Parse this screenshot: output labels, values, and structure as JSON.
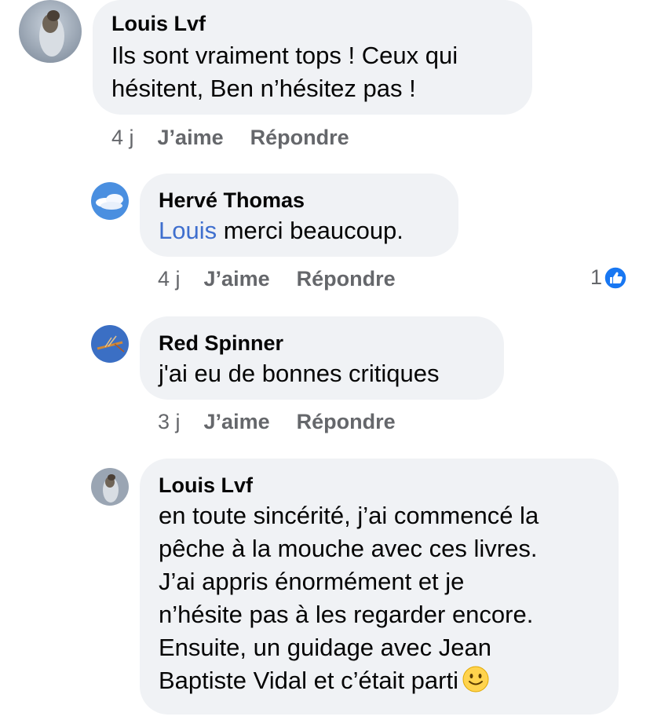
{
  "comments": [
    {
      "author": "Louis Lvf",
      "text": "Ils sont vraiment tops ! Ceux qui\nhésitent, Ben n’hésitez pas !",
      "time": "4 j",
      "like_label": "J’aime",
      "reply_label": "Répondre"
    },
    {
      "author": "Hervé Thomas",
      "mention": "Louis",
      "text": " merci beaucoup.",
      "time": "4 j",
      "like_label": "J’aime",
      "reply_label": "Répondre",
      "reaction_count": "1",
      "reaction_icon": "thumbs-up-icon"
    },
    {
      "author": "Red Spinner",
      "text": "j'ai eu de bonnes critiques",
      "time": "3 j",
      "like_label": "J’aime",
      "reply_label": "Répondre"
    },
    {
      "author": "Louis Lvf",
      "text": "en toute sincérité, j’ai commencé la\npêche à la mouche avec ces livres.\nJ’ai appris énormément et je\nn’hésite pas à les regarder encore.\nEnsuite, un guidage avec Jean\nBaptiste Vidal et c’était parti",
      "emoji": "slightly-smiling-face-icon"
    }
  ],
  "colors": {
    "bubble": "#f0f2f5",
    "meta_text": "#65676b",
    "mention": "#3f6fce",
    "like_blue": "#1877f2"
  }
}
